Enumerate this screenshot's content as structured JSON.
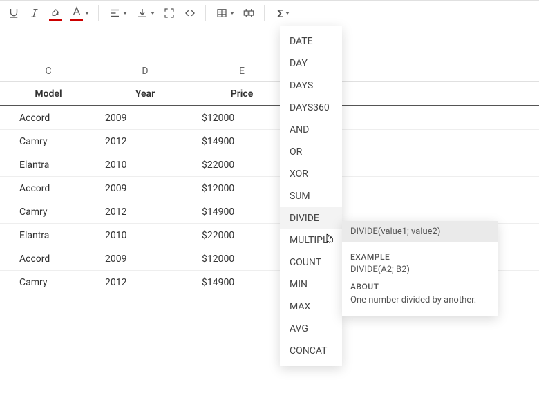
{
  "toolbar": {
    "icons": {
      "underline": "underline-icon",
      "italic": "italic-icon",
      "fill": "fill-color-icon",
      "text_color": "text-color-icon",
      "align": "align-left-icon",
      "valign": "vertical-align-bottom-icon",
      "expand": "expand-icon",
      "code": "code-icon",
      "table": "insert-table-icon",
      "table_opts": "table-options-icon",
      "formula": "formula-sum-icon"
    }
  },
  "columns": [
    "C",
    "D",
    "E"
  ],
  "headers": [
    "Model",
    "Year",
    "Price"
  ],
  "rows": [
    {
      "model": "Accord",
      "year": "2009",
      "price": "$12000"
    },
    {
      "model": "Camry",
      "year": "2012",
      "price": "$14900"
    },
    {
      "model": "Elantra",
      "year": "2010",
      "price": "$22000"
    },
    {
      "model": "Accord",
      "year": "2009",
      "price": "$12000"
    },
    {
      "model": "Camry",
      "year": "2012",
      "price": "$14900"
    },
    {
      "model": "Elantra",
      "year": "2010",
      "price": "$22000"
    },
    {
      "model": "Accord",
      "year": "2009",
      "price": "$12000"
    },
    {
      "model": "Camry",
      "year": "2012",
      "price": "$14900"
    }
  ],
  "functions": [
    "DATE",
    "DAY",
    "DAYS",
    "DAYS360",
    "AND",
    "OR",
    "XOR",
    "SUM",
    "DIVIDE",
    "MULTIPLY",
    "COUNT",
    "MIN",
    "MAX",
    "AVG",
    "CONCAT"
  ],
  "hover_function_index": 8,
  "tooltip": {
    "signature": "DIVIDE(value1; value2)",
    "example_h": "EXAMPLE",
    "example": "DIVIDE(A2; B2)",
    "about_h": "ABOUT",
    "about": "One number divided by another."
  }
}
